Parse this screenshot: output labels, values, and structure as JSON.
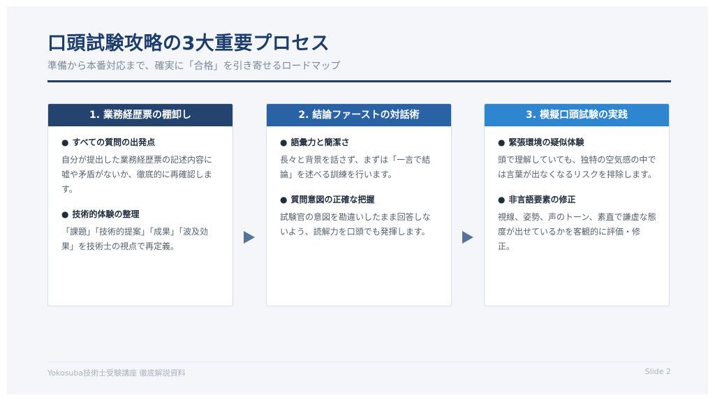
{
  "slide": {
    "title": "口頭試験攻略の3大重要プロセス",
    "subtitle": "準備から本番対応まで、確実に「合格」を引き寄せるロードマップ"
  },
  "cards": [
    {
      "header": "1. 業務経歴票の棚卸し",
      "items": [
        {
          "bullet": "●",
          "heading": "すべての質問の出発点",
          "text": "自分が提出した業務経歴票の記述内容に嘘や矛盾がないか、徹底的に再確認します。"
        },
        {
          "bullet": "●",
          "heading": "技術的体験の整理",
          "text": "「課題」「技術的提案」「成果」「波及効果」を技術士の視点で再定義。"
        }
      ]
    },
    {
      "header": "2. 結論ファーストの対話術",
      "items": [
        {
          "bullet": "●",
          "heading": "語彙力と簡潔さ",
          "text": "長々と背景を話さず、まずは「一言で結論」を述べる訓練を行います。"
        },
        {
          "bullet": "●",
          "heading": "質問意図の正確な把握",
          "text": "試験官の意図を勘違いしたまま回答しないよう、読解力を口頭でも発揮します。"
        }
      ]
    },
    {
      "header": "3. 模擬口頭試験の実践",
      "items": [
        {
          "bullet": "●",
          "heading": "緊張環境の疑似体験",
          "text": "頭で理解していても、独特の空気感の中では言葉が出なくなるリスクを排除します。"
        },
        {
          "bullet": "●",
          "heading": "非言語要素の修正",
          "text": "視線、姿勢、声のトーン、素直で謙虚な態度が出せているかを客観的に評価・修正。"
        }
      ]
    }
  ],
  "arrow_icon": "right-triangle",
  "footer": {
    "left": "Yokosuba技術士受験講座 徹底解説資料",
    "right": "Slide 2"
  },
  "colors": {
    "title": "#1c3d6e",
    "card1_header": "#24436f",
    "card2_header": "#2a62a6",
    "card3_header": "#2d86cf",
    "arrow": "#56729a"
  }
}
